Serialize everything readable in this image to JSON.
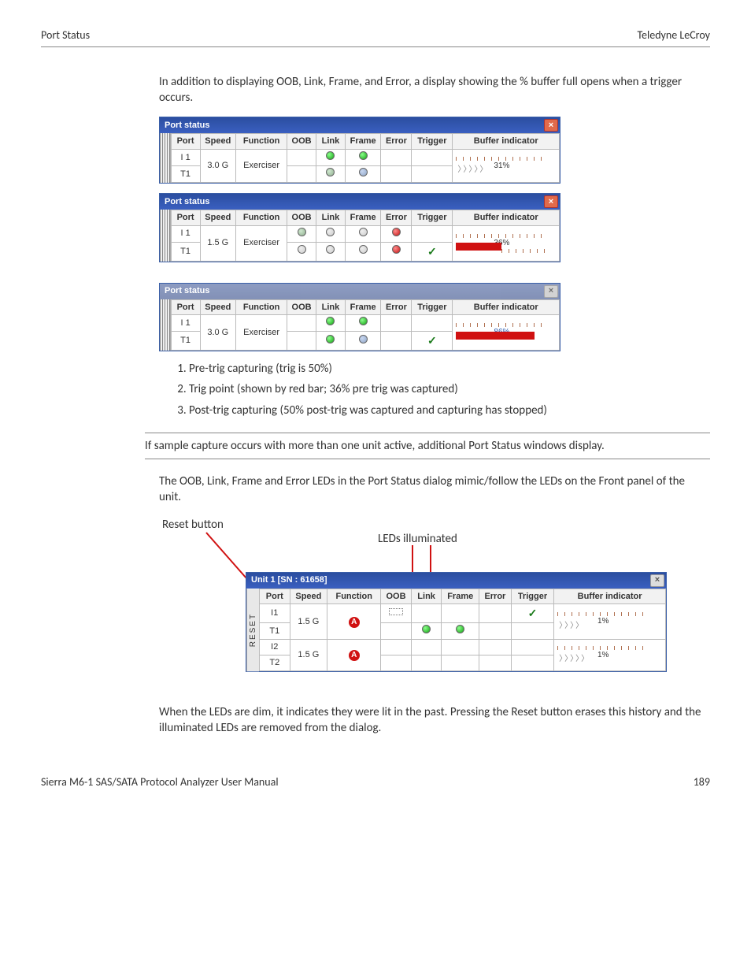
{
  "header": {
    "left": "Port Status",
    "right": "Teledyne LeCroy"
  },
  "intro": "In addition to displaying OOB, Link, Frame, and Error, a display showing the % buffer full opens when a trigger occurs.",
  "portStatus": {
    "title": "Port status",
    "headers": [
      "Port",
      "Speed",
      "Function",
      "OOB",
      "Link",
      "Frame",
      "Error",
      "Trigger",
      "Buffer indicator"
    ],
    "win1": {
      "speed": "3.0 G",
      "func": "Exerciser",
      "rows": [
        "I 1",
        "T1"
      ],
      "bufPct": "31%"
    },
    "win2": {
      "speed": "1.5 G",
      "func": "Exerciser",
      "rows": [
        "I 1",
        "T1"
      ],
      "bufPct": "36%"
    },
    "win3": {
      "speed": "3.0 G",
      "func": "Exerciser",
      "rows": [
        "I 1",
        "T1"
      ],
      "bufPct": "86%"
    }
  },
  "numbered": [
    "Pre-trig capturing (trig is 50%)",
    "Trig point (shown by red bar; 36% pre trig was captured)",
    "Post-trig capturing (50% post-trig was captured and capturing has stopped)"
  ],
  "boxedNote": "If sample capture occurs with more than one unit active, additional Port Status windows display.",
  "ledPara": "The OOB, Link, Frame and Error LEDs in the Port Status dialog mimic/follow the LEDs on the Front panel of the unit.",
  "annot": {
    "reset": "Reset button",
    "leds": "LEDs illuminated"
  },
  "unitWin": {
    "title": "Unit 1  [SN : 61658]",
    "resetLabel": "RESET",
    "speed": "1.5 G",
    "rows": [
      "I1",
      "T1",
      "I2",
      "T2"
    ],
    "bufPct": "1%"
  },
  "dimPara": "When the LEDs are dim, it indicates they were lit in the past. Pressing the Reset button erases this history and the illuminated LEDs are removed from the dialog.",
  "footer": {
    "left": "Sierra M6-1 SAS/SATA Protocol Analyzer User Manual",
    "right": "189"
  }
}
